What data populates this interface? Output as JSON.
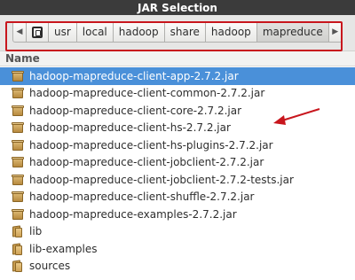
{
  "window": {
    "title": "JAR Selection"
  },
  "pathbar": {
    "nav_left": "◀",
    "nav_right": "▶",
    "root_icon": "drive-icon",
    "segments": [
      "usr",
      "local",
      "hadoop",
      "share",
      "hadoop",
      "mapreduce"
    ],
    "active_segment": "mapreduce"
  },
  "filelist": {
    "header": "Name",
    "items": [
      {
        "name": "hadoop-mapreduce-client-app-2.7.2.jar",
        "type": "jar",
        "selected": true
      },
      {
        "name": "hadoop-mapreduce-client-common-2.7.2.jar",
        "type": "jar"
      },
      {
        "name": "hadoop-mapreduce-client-core-2.7.2.jar",
        "type": "jar"
      },
      {
        "name": "hadoop-mapreduce-client-hs-2.7.2.jar",
        "type": "jar"
      },
      {
        "name": "hadoop-mapreduce-client-hs-plugins-2.7.2.jar",
        "type": "jar"
      },
      {
        "name": "hadoop-mapreduce-client-jobclient-2.7.2.jar",
        "type": "jar"
      },
      {
        "name": "hadoop-mapreduce-client-jobclient-2.7.2-tests.jar",
        "type": "jar"
      },
      {
        "name": "hadoop-mapreduce-client-shuffle-2.7.2.jar",
        "type": "jar"
      },
      {
        "name": "hadoop-mapreduce-examples-2.7.2.jar",
        "type": "jar"
      },
      {
        "name": "lib",
        "type": "folder"
      },
      {
        "name": "lib-examples",
        "type": "folder"
      },
      {
        "name": "sources",
        "type": "folder"
      }
    ]
  },
  "colors": {
    "selection": "#4a90d9",
    "annotation": "#c8161d"
  }
}
